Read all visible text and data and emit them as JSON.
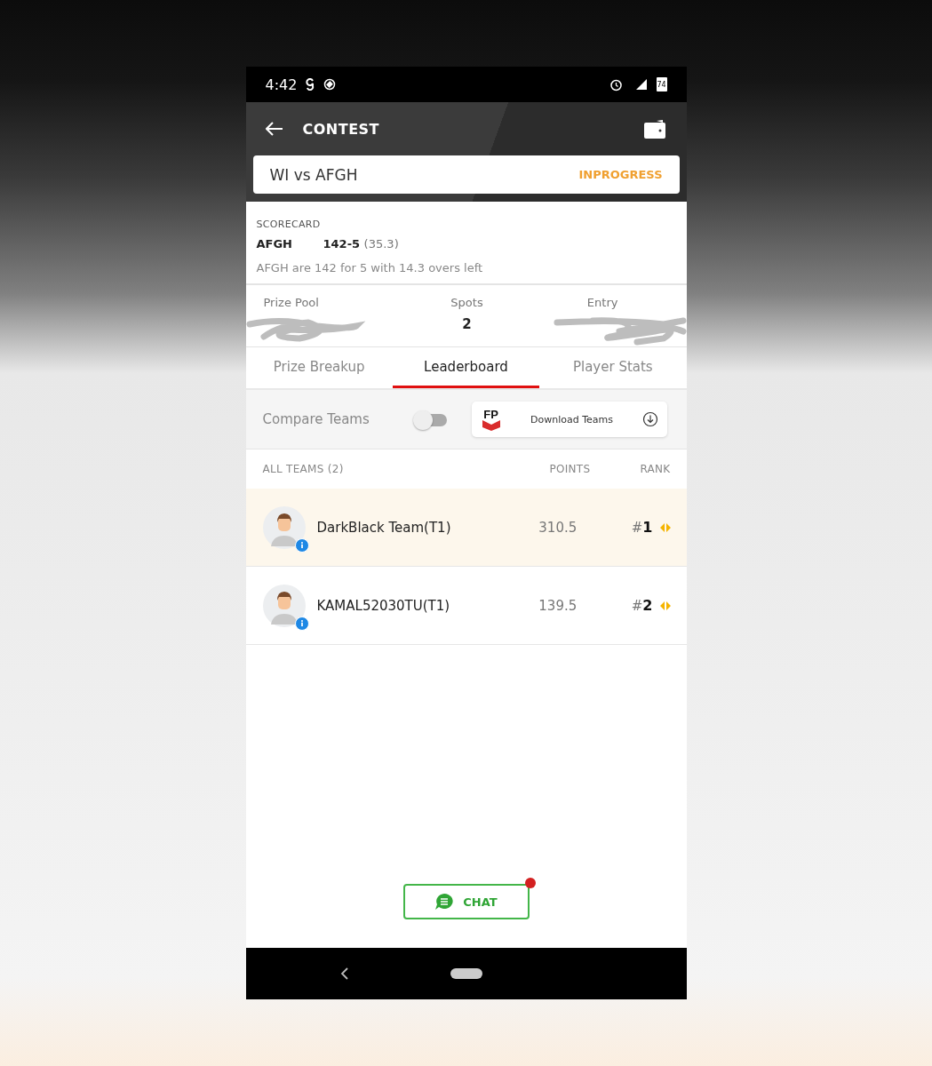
{
  "status_bar": {
    "time": "4:42",
    "battery": "74"
  },
  "header": {
    "title": "CONTEST"
  },
  "match": {
    "title": "WI vs AFGH",
    "status": "INPROGRESS"
  },
  "scorecard": {
    "label": "SCORECARD",
    "team": "AFGH",
    "score": "142-5",
    "overs": "(35.3)",
    "summary": "AFGH are 142 for 5 with 14.3 overs left"
  },
  "contest_info": [
    {
      "label": "Prize Pool"
    },
    {
      "label": "Spots",
      "value": "2"
    },
    {
      "label": "Entry"
    }
  ],
  "tabs": [
    {
      "label": "Prize Breakup",
      "selected": false
    },
    {
      "label": "Leaderboard",
      "selected": true
    },
    {
      "label": "Player Stats",
      "selected": false
    }
  ],
  "compare": {
    "label": "Compare Teams",
    "on": false
  },
  "download": {
    "logo": "FP",
    "label": "Download Teams"
  },
  "table": {
    "columns": [
      "ALL TEAMS (2)",
      "POINTS",
      "RANK"
    ],
    "rows": [
      {
        "name": "DarkBlack Team(T1)",
        "points": "310.5",
        "rank_prefix": "#",
        "rank": "1",
        "highlighted": true
      },
      {
        "name": "KAMAL52030TU(T1)",
        "points": "139.5",
        "rank_prefix": "#",
        "rank": "2",
        "highlighted": false
      }
    ]
  },
  "chat": {
    "label": "CHAT",
    "unread": true
  }
}
